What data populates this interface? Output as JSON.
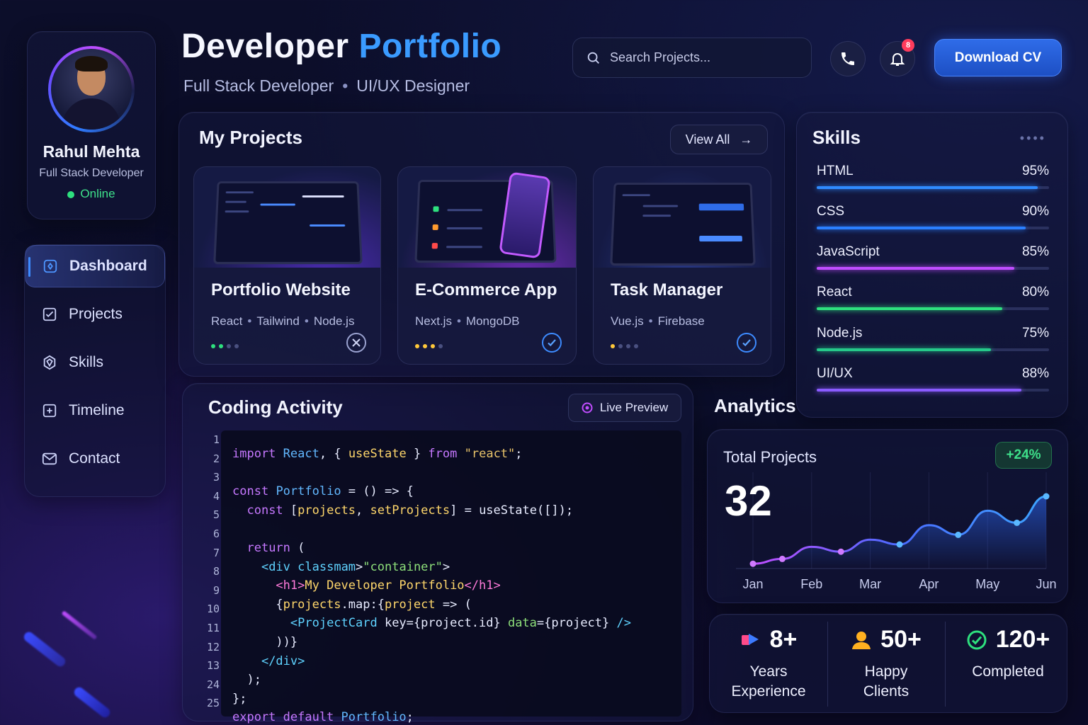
{
  "profile": {
    "name": "Rahul Mehta",
    "role": "Full Stack Developer",
    "status": "Online"
  },
  "nav": [
    {
      "label": "Dashboard",
      "icon": "dashboard-icon",
      "active": true
    },
    {
      "label": "Projects",
      "icon": "projects-icon"
    },
    {
      "label": "Skills",
      "icon": "skills-icon"
    },
    {
      "label": "Timeline",
      "icon": "timeline-icon"
    },
    {
      "label": "Contact",
      "icon": "mail-icon"
    }
  ],
  "header": {
    "title_main": "Developer",
    "title_accent": "Portfolio",
    "subtitle_left": "Full Stack Developer",
    "subtitle_sep": "•",
    "subtitle_right": "UI/UX Designer",
    "search_placeholder": "Search Projects...",
    "notification_count": "8",
    "download_label": "Download CV"
  },
  "projects": {
    "title": "My Projects",
    "view_all": "View All",
    "items": [
      {
        "title": "Portfolio Website",
        "tags": [
          "React",
          "Tailwind",
          "Node.js"
        ],
        "status": "closed"
      },
      {
        "title": "E-Commerce App",
        "tags": [
          "Next.js",
          "MongoDB"
        ],
        "status": "done"
      },
      {
        "title": "Task Manager",
        "tags": [
          "Vue.js",
          "Firebase"
        ],
        "status": "done"
      }
    ]
  },
  "skills": {
    "title": "Skills",
    "items": [
      {
        "name": "HTML",
        "percent": "95%",
        "value": 95,
        "color": "#2f8bff"
      },
      {
        "name": "CSS",
        "percent": "90%",
        "value": 90,
        "color": "#2a7fff"
      },
      {
        "name": "JavaScript",
        "percent": "85%",
        "value": 85,
        "color": "#c04dff"
      },
      {
        "name": "React",
        "percent": "80%",
        "value": 80,
        "color": "#2ee07e"
      },
      {
        "name": "Node.js",
        "percent": "75%",
        "value": 75,
        "color": "#25c98a"
      },
      {
        "name": "UI/UX",
        "percent": "88%",
        "value": 88,
        "color": "#8a5bff"
      }
    ]
  },
  "coding": {
    "title": "Coding Activity",
    "live_preview": "Live Preview",
    "line_numbers": [
      "1",
      "2",
      "3",
      "4",
      "5",
      "6",
      "7",
      "8",
      "9",
      "10",
      "11",
      "12",
      "13",
      "24",
      "25"
    ]
  },
  "analytics": {
    "title": "Analytics",
    "total_label": "Total Projects",
    "total_value": "32",
    "growth": "+24%"
  },
  "chart_data": {
    "type": "area",
    "categories": [
      "Jan",
      "Feb",
      "Mar",
      "Apr",
      "May",
      "Jun"
    ],
    "x": [
      0,
      0.5,
      1,
      1.5,
      2,
      2.5,
      3,
      3.5,
      4,
      4.5,
      5
    ],
    "values": [
      2,
      4,
      9,
      7,
      12,
      10,
      18,
      14,
      24,
      19,
      30
    ],
    "ylim": [
      0,
      40
    ]
  },
  "stats": [
    {
      "value": "8+",
      "label_1": "Years",
      "label_2": "Experience",
      "icon": "flag-icon"
    },
    {
      "value": "50+",
      "label_1": "Happy",
      "label_2": "Clients",
      "icon": "user-icon"
    },
    {
      "value": "120+",
      "label_1": "Completed",
      "label_2": "",
      "icon": "check-circle-icon"
    }
  ]
}
